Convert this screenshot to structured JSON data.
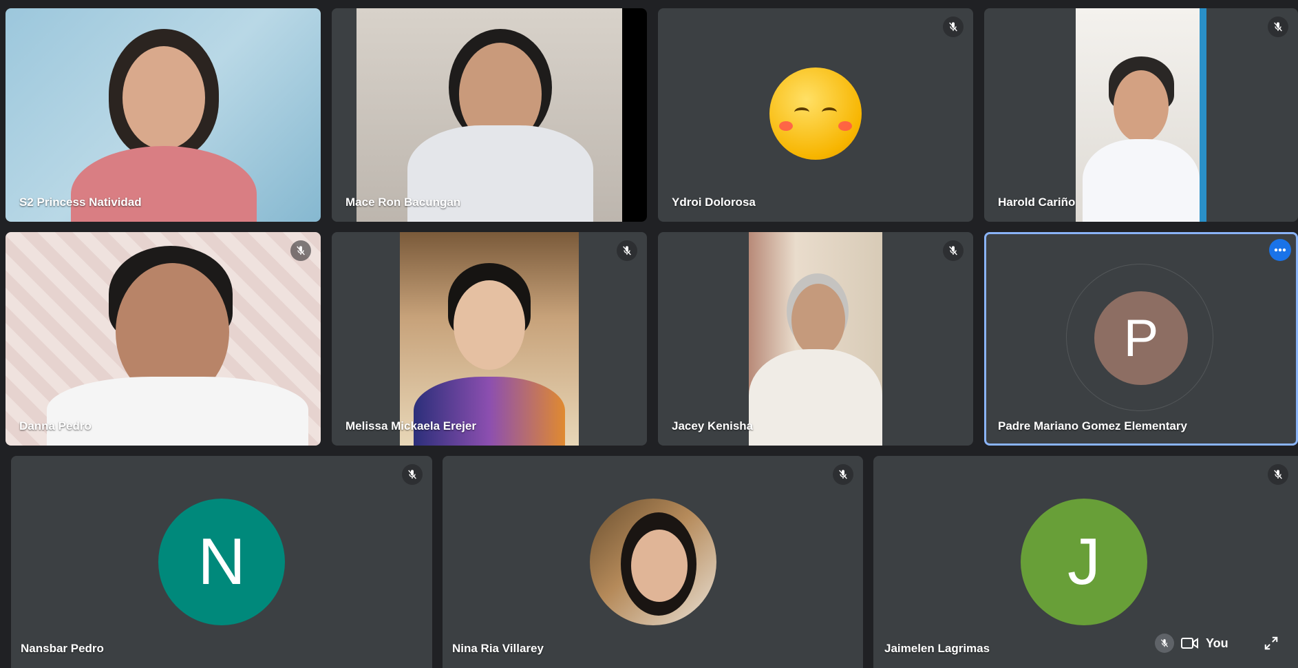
{
  "participants": [
    {
      "name": "S2 Princess Natividad",
      "muted": false
    },
    {
      "name": "Mace Ron Bacungan",
      "muted": false
    },
    {
      "name": "Ydroi Dolorosa",
      "muted": true
    },
    {
      "name": "Harold Cariño",
      "muted": true
    },
    {
      "name": "Danna Pedro",
      "muted": true
    },
    {
      "name": "Melissa Mickaela Erejer",
      "muted": true
    },
    {
      "name": "Jacey Kenisha",
      "muted": true
    },
    {
      "name": "Padre Mariano Gomez Elementary",
      "muted": false,
      "avatar_letter": "P",
      "avatar_color": "#8d6e63",
      "active": true
    },
    {
      "name": "Nansbar Pedro",
      "muted": true,
      "avatar_letter": "N",
      "avatar_color": "#00897b"
    },
    {
      "name": "Nina Ria Villarey",
      "muted": true
    },
    {
      "name": "Jaimelen Lagrimas",
      "muted": true,
      "avatar_letter": "J",
      "avatar_color": "#689f38"
    }
  ],
  "self_view": {
    "label": "You"
  },
  "colors": {
    "background": "#202124",
    "tile": "#3c4043",
    "active_border": "#8ab4f8",
    "accent": "#1a73e8"
  }
}
